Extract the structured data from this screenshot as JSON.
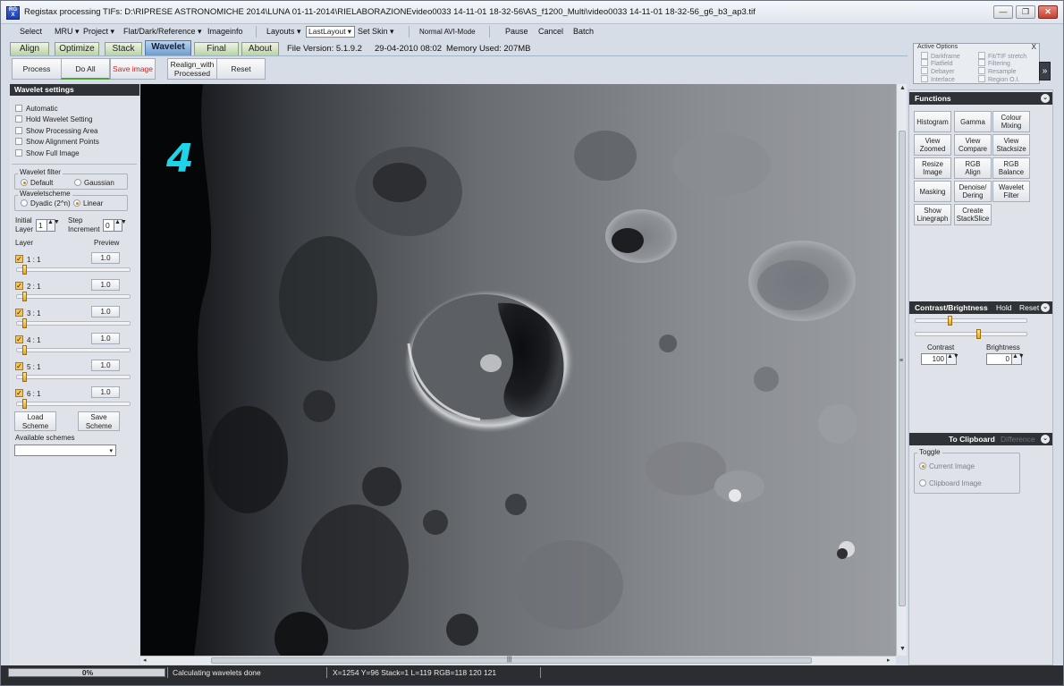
{
  "window": {
    "title": "Registax processing TIFs: D:\\RIPRESE ASTRONOMICHE 2014\\LUNA 01-11-2014\\RIELABORAZIONEvideo0033 14-11-01 18-32-56\\AS_f1200_Multi\\video0033 14-11-01 18-32-56_g6_b3_ap3.tif",
    "icon_text": "Reg\nist",
    "minimize": "—",
    "maximize": "❐",
    "close": "✕"
  },
  "menu": {
    "select": "Select",
    "mru": "MRU ▾",
    "project": "Project ▾",
    "flat": "Flat/Dark/Reference ▾",
    "imageinfo": "Imageinfo",
    "layouts": "Layouts ▾",
    "layout_value": "LastLayout",
    "layout_arrow": "▾",
    "set_skin": "Set Skin ▾",
    "avi_mode": "Normal AVI-Mode",
    "pause": "Pause",
    "cancel": "Cancel",
    "batch": "Batch"
  },
  "tabs": [
    "Align",
    "Optimize",
    "Stack",
    "Wavelet",
    "Final",
    "About"
  ],
  "file_info": {
    "version": "File Version: 5.1.9.2",
    "date": "29-04-2010 08:02",
    "memory": "Memory Used: 207MB"
  },
  "toolbar": {
    "process": "Process",
    "do_all": "Do All",
    "save_image": "Save image",
    "realign_1": "Realign_with",
    "realign_2": "Processed",
    "reset": "Reset"
  },
  "active_options": {
    "title": "Active Options",
    "close": "X",
    "items": [
      "Darkframe",
      "Flatfield",
      "Debayer",
      "Interlace",
      "Fit/TIF stretch",
      "Filtering",
      "Resample",
      "Region O.I."
    ],
    "expand": "»"
  },
  "wavelet": {
    "header": "Wavelet settings",
    "checks": [
      "Automatic",
      "Hold Wavelet Setting",
      "Show Processing Area",
      "Show Alignment Points",
      "Show Full Image"
    ],
    "filter_label": "Wavelet filter",
    "filter_default": "Default",
    "filter_gaussian": "Gaussian",
    "scheme_label": "Waveletscheme",
    "scheme_dyadic": "Dyadic (2^n)",
    "scheme_linear": "Linear",
    "initial_layer_1": "Initial",
    "initial_layer_2": "Layer",
    "initial_value": "1",
    "step_1": "Step",
    "step_2": "Increment",
    "step_value": "0",
    "layer_col": "Layer",
    "preview_col": "Preview",
    "layers": [
      {
        "name": "1 : 1",
        "value": "1.0"
      },
      {
        "name": "2 : 1",
        "value": "1.0"
      },
      {
        "name": "3 : 1",
        "value": "1.0"
      },
      {
        "name": "4 : 1",
        "value": "1.0"
      },
      {
        "name": "5 : 1",
        "value": "1.0"
      },
      {
        "name": "6 : 1",
        "value": "1.0"
      }
    ],
    "load_1": "Load",
    "load_2": "Scheme",
    "save_1": "Save",
    "save_2": "Scheme",
    "available_schemes": "Available schemes",
    "scheme_select": "",
    "spin_arrows": "▲▼",
    "combo_arrow": "▾",
    "check_mark": "✓"
  },
  "viewport": {
    "frame_number": "4",
    "scroll_up": "▲",
    "scroll_down": "▼",
    "scroll_left": "◂",
    "scroll_right": "▸",
    "scroll_grip": "|||",
    "vscroll_grip": "≡"
  },
  "functions": {
    "header": "Functions",
    "toggle": "⌄",
    "buttons": [
      [
        "Histogram"
      ],
      [
        "Gamma"
      ],
      [
        "Colour",
        "Mixing"
      ],
      [
        "View",
        "Zoomed"
      ],
      [
        "View",
        "Compare"
      ],
      [
        "View",
        "Stacksize"
      ],
      [
        "Resize",
        "Image"
      ],
      [
        "RGB",
        "Align"
      ],
      [
        "RGB",
        "Balance"
      ],
      [
        "Masking"
      ],
      [
        "Denoise/",
        "Dering"
      ],
      [
        "Wavelet",
        "Filter"
      ],
      [
        "Show",
        "Linegraph"
      ],
      [
        "Create",
        "StackSlice"
      ]
    ]
  },
  "contrast": {
    "header": "Contrast/Brightness",
    "hold": "Hold",
    "reset": "Reset",
    "toggle": "⌄",
    "contrast_label": "Contrast",
    "contrast_value": "100",
    "brightness_label": "Brightness",
    "brightness_value": "0",
    "arrows": "▲▼"
  },
  "clipboard": {
    "header": "To Clipboard",
    "difference": "Difference",
    "toggle": "⌄",
    "toggle_label": "Toggle",
    "current": "Current Image",
    "clipboard": "Clipboard Image"
  },
  "status": {
    "progress_pct": 0,
    "progress_text": "0%",
    "message": "Calculating wavelets done",
    "coords": "X=1254 Y=96 Stack=1 L=119 RGB=118 120 121"
  },
  "colors": {
    "frame_number": "#1fd3e8",
    "active_tab": "#6f9ccd",
    "progress": "#f4d034"
  }
}
